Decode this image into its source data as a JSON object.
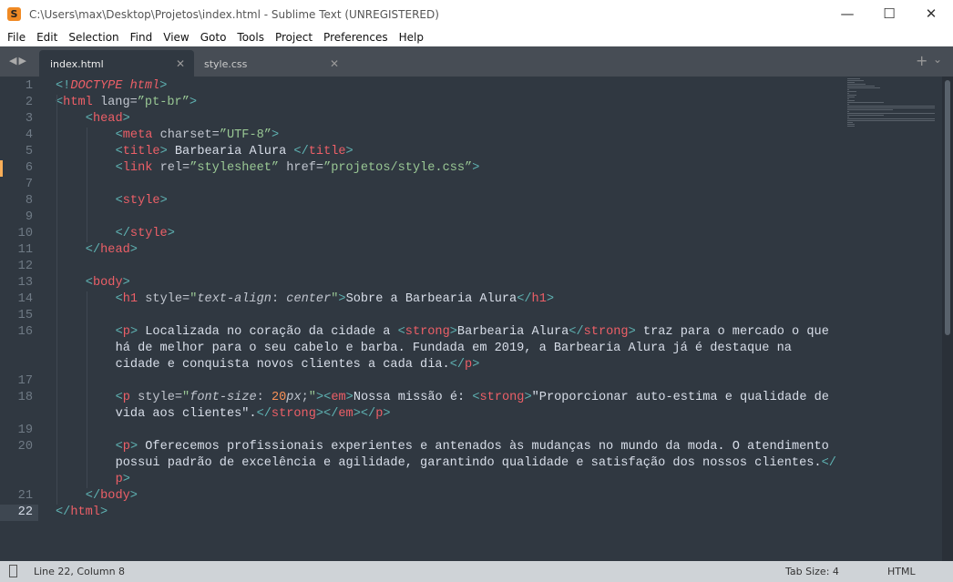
{
  "window": {
    "title": "C:\\Users\\max\\Desktop\\Projetos\\index.html - Sublime Text (UNREGISTERED)",
    "app_icon": "S"
  },
  "menu": [
    "File",
    "Edit",
    "Selection",
    "Find",
    "View",
    "Goto",
    "Tools",
    "Project",
    "Preferences",
    "Help"
  ],
  "tabs": [
    {
      "label": "index.html",
      "active": true
    },
    {
      "label": "style.css",
      "active": false
    }
  ],
  "editor": {
    "current_line": 22,
    "modified_line": 6,
    "lines": [
      {
        "n": "1",
        "rows": [
          [
            [
              "<!",
              "b"
            ],
            [
              "DOCTYPE html",
              "d"
            ],
            [
              ">",
              "b"
            ]
          ]
        ]
      },
      {
        "n": "2",
        "rows": [
          [
            [
              "<",
              "b"
            ],
            [
              "html",
              "t"
            ],
            [
              " lang=",
              "a"
            ],
            [
              "”pt-br”",
              "s"
            ],
            [
              ">",
              "b"
            ]
          ]
        ]
      },
      {
        "n": "3",
        "ind": 4,
        "rows": [
          [
            [
              "<",
              "b"
            ],
            [
              "head",
              "t"
            ],
            [
              ">",
              "b"
            ]
          ]
        ]
      },
      {
        "n": "4",
        "ind": 8,
        "rows": [
          [
            [
              "<",
              "b"
            ],
            [
              "meta",
              "t"
            ],
            [
              " charset=",
              "a"
            ],
            [
              "”UTF-8”",
              "s"
            ],
            [
              ">",
              "b"
            ]
          ]
        ]
      },
      {
        "n": "5",
        "ind": 8,
        "rows": [
          [
            [
              "<",
              "b"
            ],
            [
              "title",
              "t"
            ],
            [
              ">",
              "b"
            ],
            [
              " Barbearia Alura ",
              "x"
            ],
            [
              "</",
              "b"
            ],
            [
              "title",
              "t"
            ],
            [
              ">",
              "b"
            ]
          ]
        ]
      },
      {
        "n": "6",
        "ind": 8,
        "rows": [
          [
            [
              "<",
              "b"
            ],
            [
              "link",
              "t"
            ],
            [
              " rel=",
              "a"
            ],
            [
              "”stylesheet”",
              "s"
            ],
            [
              " href=",
              "a"
            ],
            [
              "”projetos/style.css”",
              "s"
            ],
            [
              ">",
              "b"
            ]
          ]
        ]
      },
      {
        "n": "7",
        "rows": [
          []
        ]
      },
      {
        "n": "8",
        "ind": 8,
        "rows": [
          [
            [
              "<",
              "b"
            ],
            [
              "style",
              "t"
            ],
            [
              ">",
              "b"
            ]
          ]
        ]
      },
      {
        "n": "9",
        "rows": [
          []
        ]
      },
      {
        "n": "10",
        "ind": 8,
        "rows": [
          [
            [
              "</",
              "b"
            ],
            [
              "style",
              "t"
            ],
            [
              ">",
              "b"
            ]
          ]
        ]
      },
      {
        "n": "11",
        "ind": 4,
        "rows": [
          [
            [
              "</",
              "b"
            ],
            [
              "head",
              "t"
            ],
            [
              ">",
              "b"
            ]
          ]
        ]
      },
      {
        "n": "12",
        "rows": [
          []
        ]
      },
      {
        "n": "13",
        "ind": 4,
        "rows": [
          [
            [
              "<",
              "b"
            ],
            [
              "body",
              "t"
            ],
            [
              ">",
              "b"
            ]
          ]
        ]
      },
      {
        "n": "14",
        "ind": 8,
        "rows": [
          [
            [
              "<",
              "b"
            ],
            [
              "h1",
              "t"
            ],
            [
              " style=",
              "a"
            ],
            [
              "\"",
              "s"
            ],
            [
              "text-align",
              "iv"
            ],
            [
              ": ",
              "a"
            ],
            [
              "center",
              "iv"
            ],
            [
              "\"",
              "s"
            ],
            [
              ">",
              "b"
            ],
            [
              "Sobre a Barbearia Alura",
              "x"
            ],
            [
              "</",
              "b"
            ],
            [
              "h1",
              "t"
            ],
            [
              ">",
              "b"
            ]
          ]
        ]
      },
      {
        "n": "15",
        "rows": [
          []
        ]
      },
      {
        "n": "16",
        "ind": 8,
        "rows": [
          [
            [
              "<",
              "b"
            ],
            [
              "p",
              "t"
            ],
            [
              ">",
              "b"
            ],
            [
              " Localizada no coração da cidade a ",
              "x"
            ],
            [
              "<",
              "b"
            ],
            [
              "strong",
              "t"
            ],
            [
              ">",
              "b"
            ],
            [
              "Barbearia Alura",
              "x"
            ],
            [
              "</",
              "b"
            ],
            [
              "strong",
              "t"
            ],
            [
              ">",
              "b"
            ],
            [
              " traz para o mercado o que",
              "x"
            ]
          ],
          [
            [
              "há de melhor para o seu cabelo e barba. Fundada em 2019, a Barbearia Alura já é destaque na",
              "x"
            ]
          ],
          [
            [
              "cidade e conquista novos clientes a cada dia.",
              "x"
            ],
            [
              "</",
              "b"
            ],
            [
              "p",
              "t"
            ],
            [
              ">",
              "b"
            ]
          ]
        ]
      },
      {
        "n": "17",
        "rows": [
          []
        ]
      },
      {
        "n": "18",
        "ind": 8,
        "rows": [
          [
            [
              "<",
              "b"
            ],
            [
              "p",
              "t"
            ],
            [
              " style=",
              "a"
            ],
            [
              "\"",
              "s"
            ],
            [
              "font-size",
              "iv"
            ],
            [
              ": ",
              "a"
            ],
            [
              "20",
              "n"
            ],
            [
              "px",
              "iv"
            ],
            [
              ";",
              "a"
            ],
            [
              "\"",
              "s"
            ],
            [
              ">",
              "b"
            ],
            [
              "<",
              "b"
            ],
            [
              "em",
              "t"
            ],
            [
              ">",
              "b"
            ],
            [
              "Nossa missão é: ",
              "x"
            ],
            [
              "<",
              "b"
            ],
            [
              "strong",
              "t"
            ],
            [
              ">",
              "b"
            ],
            [
              "\"Proporcionar auto-estima e qualidade de",
              "x"
            ]
          ],
          [
            [
              "vida aos clientes\".",
              "x"
            ],
            [
              "</",
              "b"
            ],
            [
              "strong",
              "t"
            ],
            [
              ">",
              "b"
            ],
            [
              "</",
              "b"
            ],
            [
              "em",
              "t"
            ],
            [
              ">",
              "b"
            ],
            [
              "</",
              "b"
            ],
            [
              "p",
              "t"
            ],
            [
              ">",
              "b"
            ]
          ]
        ]
      },
      {
        "n": "19",
        "rows": [
          []
        ]
      },
      {
        "n": "20",
        "ind": 8,
        "rows": [
          [
            [
              "<",
              "b"
            ],
            [
              "p",
              "t"
            ],
            [
              ">",
              "b"
            ],
            [
              " Oferecemos profissionais experientes e antenados às mudanças no mundo da moda. O atendimento",
              "x"
            ]
          ],
          [
            [
              "possui padrão de excelência e agilidade, garantindo qualidade e satisfação dos nossos clientes.",
              "x"
            ],
            [
              "</",
              "b"
            ]
          ],
          [
            [
              "p",
              "t"
            ],
            [
              ">",
              "b"
            ]
          ]
        ]
      },
      {
        "n": "21",
        "ind": 4,
        "rows": [
          [
            [
              "</",
              "b"
            ],
            [
              "body",
              "t"
            ],
            [
              ">",
              "b"
            ]
          ]
        ]
      },
      {
        "n": "22",
        "rows": [
          [
            [
              "</",
              "b"
            ],
            [
              "html",
              "t"
            ],
            [
              ">",
              "b"
            ]
          ]
        ]
      }
    ]
  },
  "status": {
    "position": "Line 22, Column 8",
    "tab_size": "Tab Size: 4",
    "syntax": "HTML"
  },
  "colors": {
    "background": "#303841",
    "tag": "#ec5f67",
    "string": "#99c794",
    "bracket": "#5fb3b3",
    "number": "#f99157",
    "modified_marker": "#f9ae58"
  }
}
